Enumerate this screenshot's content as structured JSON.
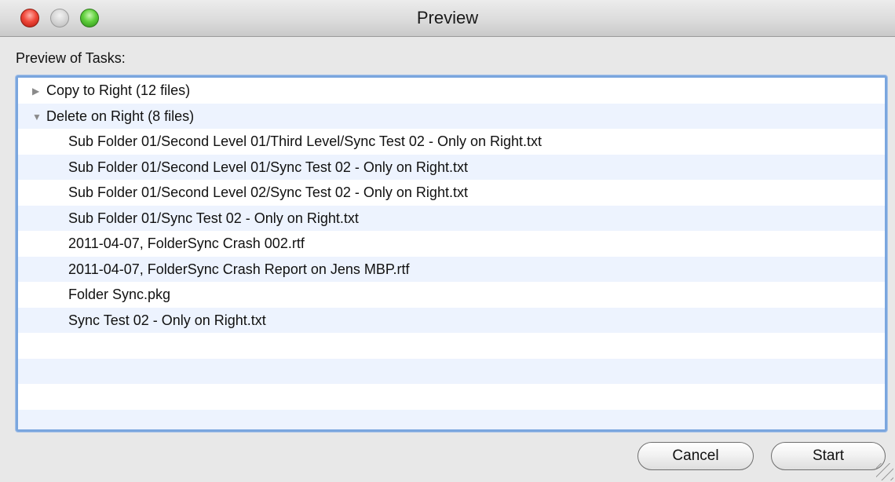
{
  "window": {
    "title": "Preview"
  },
  "section_label": "Preview of Tasks:",
  "tree": {
    "groups": [
      {
        "label": "Copy to Right (12 files)",
        "expanded": false
      },
      {
        "label": "Delete on Right (8 files)",
        "expanded": true
      }
    ],
    "children": [
      "Sub Folder 01/Second Level 01/Third Level/Sync Test 02 - Only on Right.txt",
      "Sub Folder 01/Second Level 01/Sync Test 02 - Only on Right.txt",
      "Sub Folder 01/Second Level 02/Sync Test 02 - Only on Right.txt",
      "Sub Folder 01/Sync Test 02 - Only on Right.txt",
      "2011-04-07, FolderSync Crash 002.rtf",
      "2011-04-07, FolderSync Crash Report on Jens MBP.rtf",
      "Folder Sync.pkg",
      "Sync Test 02 - Only on Right.txt"
    ],
    "disclosure_icons": {
      "collapsed": "▶",
      "expanded": "▼"
    }
  },
  "buttons": {
    "cancel": "Cancel",
    "start": "Start"
  }
}
